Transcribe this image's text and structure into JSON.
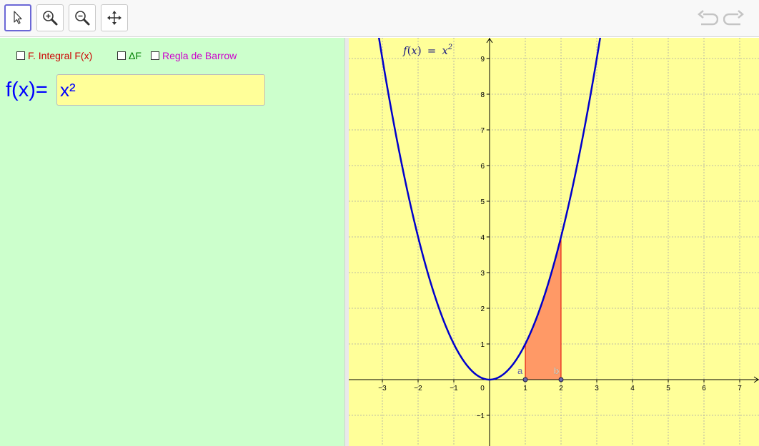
{
  "toolbar": {
    "tools": [
      {
        "name": "move-tool",
        "icon": "pointer-arrow-icon",
        "active": true
      },
      {
        "name": "zoom-in-tool",
        "icon": "zoom-in-icon",
        "active": false
      },
      {
        "name": "zoom-out-tool",
        "icon": "zoom-out-icon",
        "active": false
      },
      {
        "name": "move-graphics-tool",
        "icon": "move-arrows-icon",
        "active": false
      }
    ],
    "history": {
      "undo_icon": "undo-icon",
      "redo_icon": "redo-icon"
    }
  },
  "algebra": {
    "checkboxes": [
      {
        "label": "F. Integral F(x)",
        "checked": false,
        "color": "#cc0000"
      },
      {
        "label": "ΔF",
        "checked": false,
        "color": "#008000"
      },
      {
        "label": "Regla de Barrow",
        "checked": false,
        "color": "#cc00cc"
      }
    ],
    "function_label": "f(x)=",
    "function_value": "x²"
  },
  "graph": {
    "curve_label": {
      "f": "f",
      "x": "x",
      "eq": "=",
      "base": "x",
      "exp": "2"
    },
    "x_ticks": [
      -3,
      -2,
      -1,
      0,
      1,
      2,
      3,
      4,
      5,
      6,
      7
    ],
    "y_ticks": [
      -1,
      1,
      2,
      3,
      4,
      5,
      6,
      7,
      8,
      9
    ],
    "x_range": [
      -3.9,
      7.5
    ],
    "y_range": [
      -1.8,
      9.7
    ],
    "curve_color": "#0000cc",
    "area_color": "#ff9966",
    "area_border_color": "#dd0000",
    "background_color": "#ffff99",
    "grid": true,
    "point_a": {
      "label": "a",
      "x": 1,
      "y": 0
    },
    "point_b": {
      "label": "b",
      "x": 2,
      "y": 0
    },
    "integral_bounds": [
      1,
      2
    ]
  }
}
